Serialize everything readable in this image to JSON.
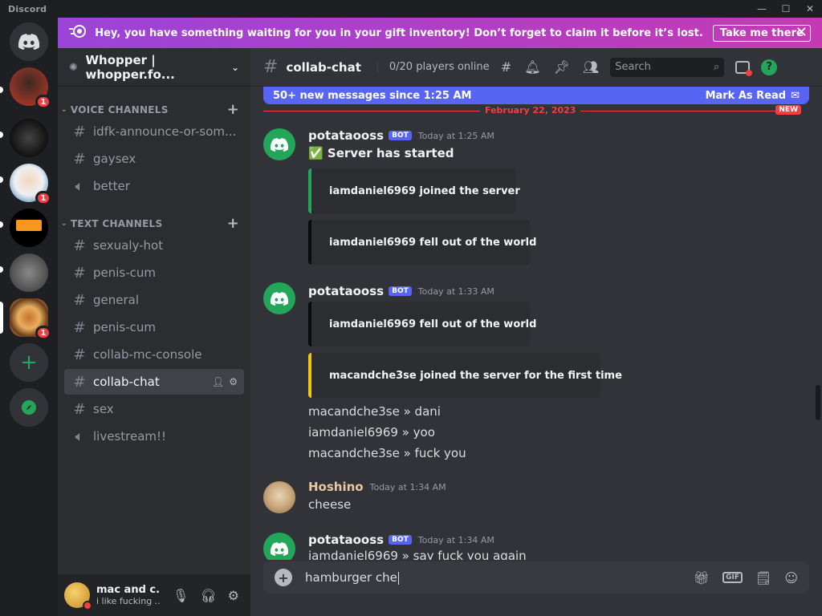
{
  "titlebar": {
    "app_name": "Discord"
  },
  "notice": {
    "text": "Hey, you have something waiting for you in your gift inventory! Don’t forget to claim it before it’s lost.",
    "cta": "Take me there"
  },
  "servers": [
    {
      "name": "server-1",
      "badge": "1"
    },
    {
      "name": "server-2",
      "badge": ""
    },
    {
      "name": "server-3",
      "badge": "1"
    },
    {
      "name": "server-4",
      "badge": ""
    },
    {
      "name": "server-5",
      "badge": ""
    },
    {
      "name": "server-6",
      "badge": "1"
    }
  ],
  "guild": {
    "name": "Whopper | whopper.fo..."
  },
  "voice_category": {
    "label": "VOICE CHANNELS"
  },
  "text_category": {
    "label": "TEXT CHANNELS"
  },
  "voice_channels": [
    {
      "label": "idfk-announce-or-som..."
    },
    {
      "label": "gaysex"
    },
    {
      "label": "better"
    }
  ],
  "text_channels": [
    {
      "label": "sexualy-hot"
    },
    {
      "label": "penis-cum"
    },
    {
      "label": "general"
    },
    {
      "label": "penis-cum"
    },
    {
      "label": "collab-mc-console"
    },
    {
      "label": "collab-chat"
    },
    {
      "label": "sex"
    },
    {
      "label": "livestream!!"
    }
  ],
  "user": {
    "name": "mac and c...",
    "status": "i like fucking ..."
  },
  "channel": {
    "name": "collab-chat",
    "topic": "0/20 players online | 1..."
  },
  "search": {
    "placeholder": "Search"
  },
  "new_messages": {
    "text": "50+ new messages since 1:25 AM",
    "mark": "Mark As Read"
  },
  "divider": {
    "date": "February 22, 2023",
    "new": "NEW"
  },
  "messages": {
    "m1": {
      "user": "potataooss",
      "bot": "BOT",
      "time": "Today at 1:25 AM",
      "text": "✅ Server has started",
      "embeds": [
        "iamdaniel6969 joined the server",
        "iamdaniel6969 fell out of the world"
      ]
    },
    "m2": {
      "user": "potataooss",
      "bot": "BOT",
      "time": "Today at 1:33 AM",
      "embeds": [
        "iamdaniel6969 fell out of the world",
        "macandche3se joined the server for the first time"
      ],
      "lines": [
        "macandche3se » dani",
        "iamdaniel6969 » yoo",
        "macandche3se » fuck you"
      ]
    },
    "m3": {
      "user": "Hoshino",
      "time": "Today at 1:34 AM",
      "text": "cheese"
    },
    "m4": {
      "user": "potataooss",
      "bot": "BOT",
      "time": "Today at 1:34 AM",
      "text": "iamdaniel6969 » say fuck you again"
    }
  },
  "composer": {
    "value": "hamburger che",
    "gif": "GIF"
  },
  "colors": {
    "blurple": "#5865f2",
    "green": "#23a55a",
    "red": "#f23f42"
  }
}
